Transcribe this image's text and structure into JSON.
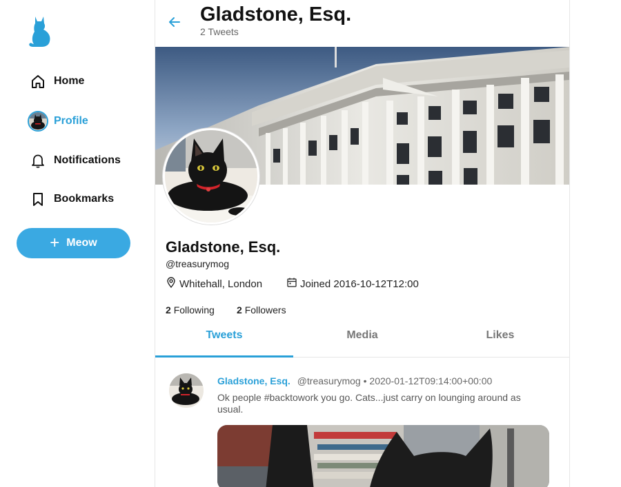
{
  "sidebar": {
    "logo_icon": "cat-logo-icon",
    "items": [
      {
        "label": "Home",
        "icon": "home-icon"
      },
      {
        "label": "Profile",
        "icon": "avatar"
      },
      {
        "label": "Notifications",
        "icon": "bell-icon"
      },
      {
        "label": "Bookmarks",
        "icon": "bookmark-icon"
      }
    ],
    "compose_label": "Meow",
    "compose_icon": "plus-icon"
  },
  "header": {
    "title": "Gladstone, Esq.",
    "subtitle": "2 Tweets"
  },
  "profile": {
    "name": "Gladstone, Esq.",
    "handle": "@treasurymog",
    "location": "Whitehall, London",
    "joined": "Joined 2016-10-12T12:00",
    "following_count": "2",
    "following_label": "Following",
    "followers_count": "2",
    "followers_label": "Followers"
  },
  "tabs": [
    {
      "label": "Tweets",
      "active": true
    },
    {
      "label": "Media",
      "active": false
    },
    {
      "label": "Likes",
      "active": false
    }
  ],
  "tweets": [
    {
      "name": "Gladstone, Esq.",
      "meta": "@treasurymog • 2020-01-12T09:14:00+00:00",
      "text": "Ok people #backtowork you go. Cats...just carry on lounging around as usual."
    }
  ],
  "colors": {
    "accent": "#2aa0d8",
    "compose_button": "#3aa9e2"
  }
}
